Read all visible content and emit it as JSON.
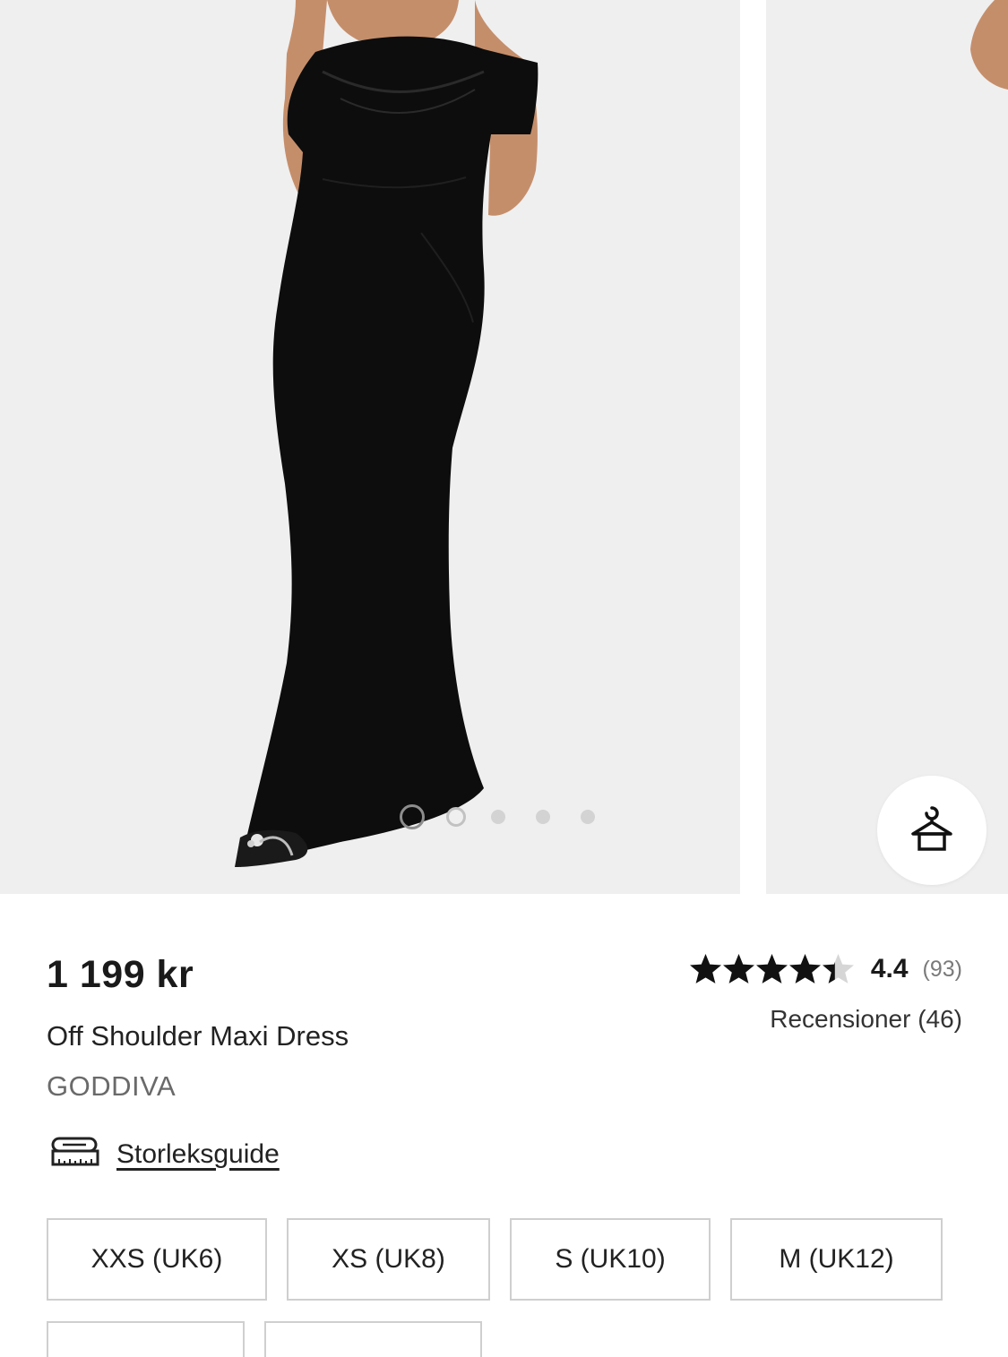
{
  "gallery": {
    "slide_count": 5,
    "active_index": 0,
    "try_on_icon": "hanger-icon"
  },
  "product": {
    "price": "1 199 kr",
    "title": "Off Shoulder Maxi Dress",
    "brand": "GODDIVA"
  },
  "rating": {
    "value": "4.4",
    "count": "(93)",
    "stars_filled": 4.4,
    "stars_total": 5,
    "reviews_label": "Recensioner (46)"
  },
  "size_guide": {
    "label": "Storleksguide",
    "icon": "measuring-tape-icon"
  },
  "sizes": [
    "XXS (UK6)",
    "XS (UK8)",
    "S (UK10)",
    "M (UK12)"
  ],
  "colors": {
    "image_background": "#efefef",
    "dress": "#0d0d0d",
    "star": "#111111",
    "star_empty": "#d6d6d6"
  }
}
